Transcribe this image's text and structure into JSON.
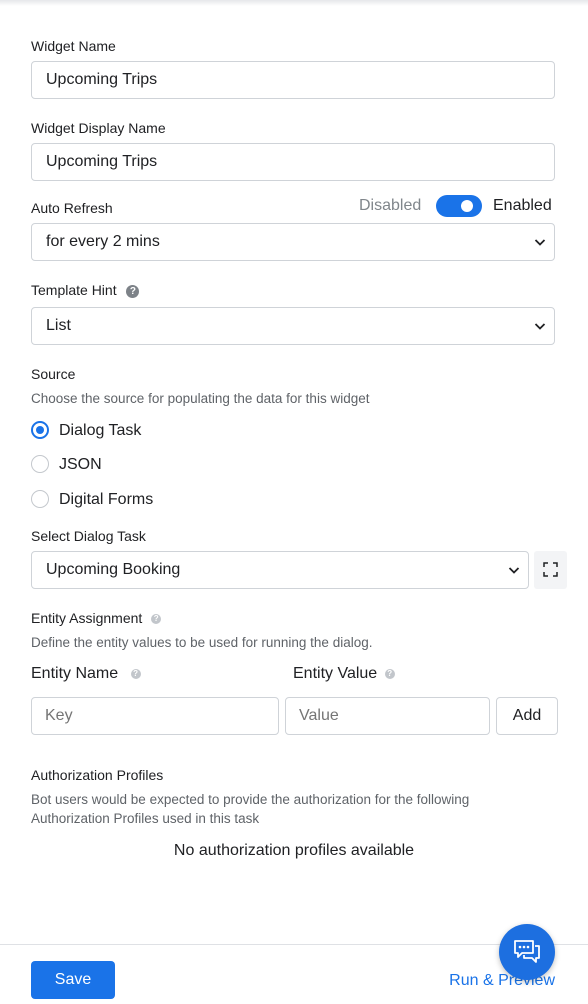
{
  "widget_name": {
    "label": "Widget Name",
    "value": "Upcoming Trips"
  },
  "widget_display_name": {
    "label": "Widget Display Name",
    "value": "Upcoming Trips"
  },
  "auto_refresh": {
    "label": "Auto Refresh",
    "toggle_off_label": "Disabled",
    "toggle_on_label": "Enabled",
    "enabled": true,
    "selected": "for every 2 mins"
  },
  "template_hint": {
    "label": "Template Hint",
    "help_icon": "question-circle-icon",
    "selected": "List"
  },
  "source": {
    "label": "Source",
    "description": "Choose the source for populating the data for this widget",
    "options": [
      "Dialog Task",
      "JSON",
      "Digital Forms"
    ],
    "selected": "Dialog Task"
  },
  "dialog_task": {
    "label": "Select Dialog Task",
    "selected": "Upcoming Booking",
    "expand_icon": "expand-icon"
  },
  "entity_assignment": {
    "label": "Entity Assignment",
    "description": "Define the entity values to be used for running the dialog.",
    "name_label": "Entity Name",
    "value_label": "Entity Value",
    "key_placeholder": "Key",
    "value_placeholder": "Value",
    "add_label": "Add"
  },
  "authorization": {
    "label": "Authorization Profiles",
    "description": "Bot users would be expected to provide the authorization for the following Authorization Profiles used in this task",
    "empty": "No authorization profiles available"
  },
  "footer": {
    "save_label": "Save",
    "run_label": "Run & Preview",
    "chat_icon": "chat-bubbles-icon"
  },
  "colors": {
    "accent": "#1a73e8",
    "chat_button": "#1d6fe0"
  }
}
